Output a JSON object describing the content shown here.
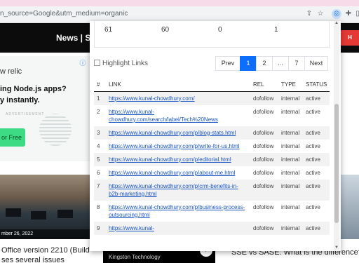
{
  "browser": {
    "url": "n_source=Google&utm_medium=organic",
    "icons": [
      "share-icon",
      "star-icon",
      "extension-active-icon",
      "puzzle-icon",
      "sidepanel-icon"
    ]
  },
  "site": {
    "nav": "News | Sit",
    "ad": {
      "line1": "w relic",
      "line2": "ing Node.js apps?",
      "line3": "y instantly.",
      "watermark": "ADVERTISEMENT",
      "cta": "or Free"
    },
    "left_story": {
      "date": "mber 26, 2022",
      "line1": "Office version 2210 (Build",
      "line2": "ses several issues"
    },
    "right_story": {
      "title": "SSE vs SASE: What is the difference?"
    },
    "kingston": {
      "brand": "Kingston Technology"
    }
  },
  "popup": {
    "stats": [
      "61",
      "60",
      "0",
      "1"
    ],
    "highlight_label": "Highlight Links",
    "pager": {
      "prev": "Prev",
      "pages": [
        "1",
        "2",
        "...",
        "7"
      ],
      "active": "1",
      "next": "Next"
    },
    "columns": [
      "#",
      "LINK",
      "REL",
      "TYPE",
      "STATUS"
    ],
    "rows": [
      {
        "n": "1",
        "link": "https://www.kunal-chowdhury.com/",
        "rel": "dofollow",
        "type": "internal",
        "status": "active"
      },
      {
        "n": "2",
        "link": "https://www.kunal-chowdhury.com/search/label/Tech%20News",
        "rel": "dofollow",
        "type": "internal",
        "status": "active"
      },
      {
        "n": "3",
        "link": "https://www.kunal-chowdhury.com/p/blog-stats.html",
        "rel": "dofollow",
        "type": "internal",
        "status": "active"
      },
      {
        "n": "4",
        "link": "https://www.kunal-chowdhury.com/p/write-for-us.html",
        "rel": "dofollow",
        "type": "internal",
        "status": "active"
      },
      {
        "n": "5",
        "link": "https://www.kunal-chowdhury.com/p/editorial.html",
        "rel": "dofollow",
        "type": "internal",
        "status": "active"
      },
      {
        "n": "6",
        "link": "https://www.kunal-chowdhury.com/p/about-me.html",
        "rel": "dofollow",
        "type": "internal",
        "status": "active"
      },
      {
        "n": "7",
        "link": "https://www.kunal-chowdhury.com/p/crm-benefits-in-b2b-marketing.html",
        "rel": "dofollow",
        "type": "internal",
        "status": "active"
      },
      {
        "n": "8",
        "link": "https://www.kunal-chowdhury.com/p/business-process-outsourcing.html",
        "rel": "dofollow",
        "type": "internal",
        "status": "active"
      },
      {
        "n": "9",
        "link": "https://www.kunal-",
        "rel": "dofollow",
        "type": "internal",
        "status": "active"
      }
    ]
  }
}
